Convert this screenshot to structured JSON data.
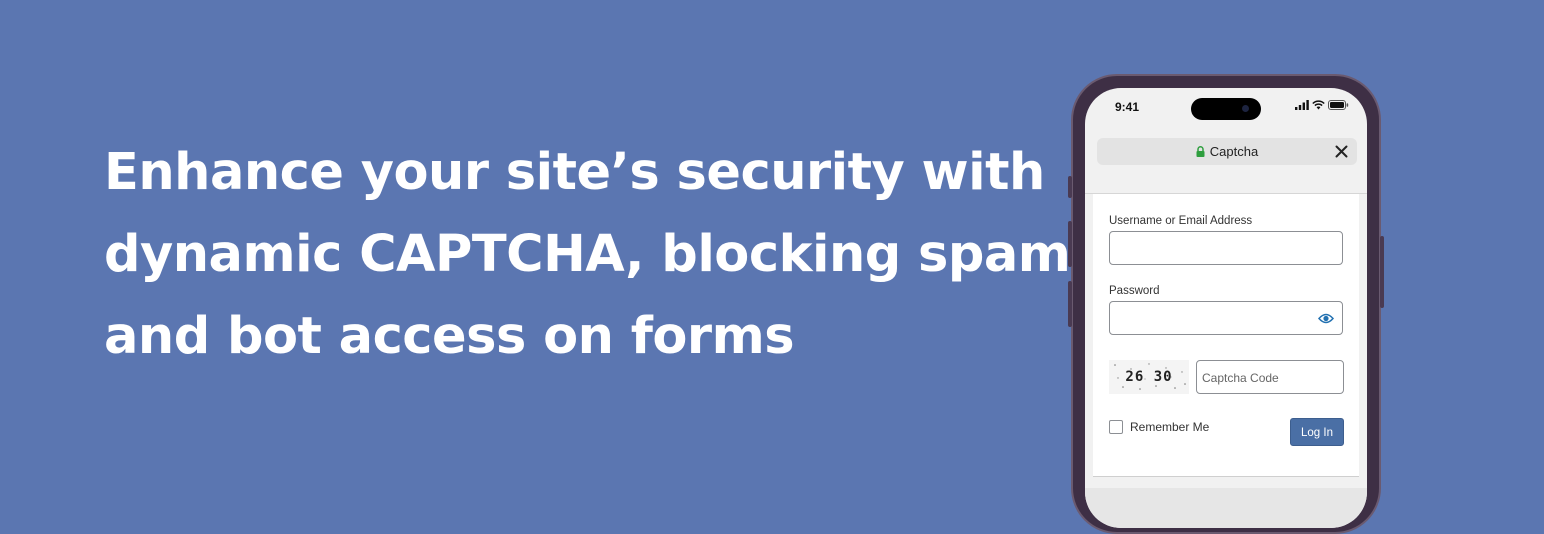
{
  "headline": {
    "line1": "Enhance your site’s security with",
    "line2": "dynamic CAPTCHA, blocking spam",
    "line3": "and bot access on forms"
  },
  "phone": {
    "status_time": "9:41",
    "url_title": "Captcha",
    "lock_icon": "lock-icon",
    "close_icon": "close-icon"
  },
  "login_form": {
    "username_label": "Username or Email Address",
    "username_value": "",
    "password_label": "Password",
    "password_value": "",
    "captcha_code_image": "26  30",
    "captcha_placeholder": "Captcha Code",
    "remember_label": "Remember Me",
    "remember_checked": false,
    "login_button": "Log In"
  },
  "colors": {
    "background": "#5b76b1",
    "headline_text": "#ffffff",
    "lock_green": "#2e9e3e",
    "button_blue": "#4a6fa5",
    "phone_frame": "#3e2f45"
  }
}
